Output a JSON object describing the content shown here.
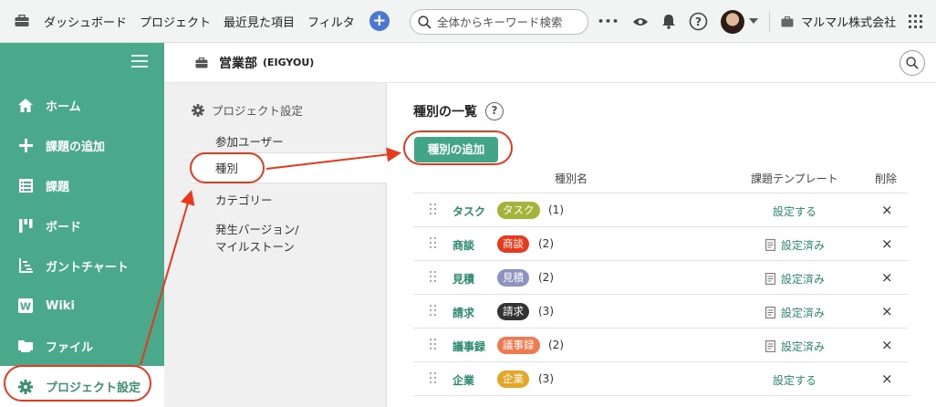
{
  "topbar": {
    "nav": [
      "ダッシュボード",
      "プロジェクト",
      "最近見た項目",
      "フィルタ"
    ],
    "add_label": "+",
    "search_placeholder": "全体からキーワード検索",
    "more_label": "•••",
    "company": "マルマル株式会社"
  },
  "sidebar": {
    "items": [
      {
        "label": "ホーム",
        "icon": "home-icon"
      },
      {
        "label": "課題の追加",
        "icon": "plus-icon"
      },
      {
        "label": "課題",
        "icon": "list-icon"
      },
      {
        "label": "ボード",
        "icon": "board-icon"
      },
      {
        "label": "ガントチャート",
        "icon": "gantt-icon"
      },
      {
        "label": "Wiki",
        "icon": "wiki-icon"
      },
      {
        "label": "ファイル",
        "icon": "folder-icon"
      },
      {
        "label": "プロジェクト設定",
        "icon": "gear-icon",
        "active": true
      }
    ]
  },
  "project": {
    "name": "営業部",
    "key": "(EIGYOU)"
  },
  "settings_panel": {
    "title": "プロジェクト設定",
    "items": [
      "参加ユーザー",
      "種別",
      "カテゴリー",
      "発生バージョン/",
      "マイルストーン"
    ],
    "active": "種別"
  },
  "main": {
    "title": "種別の一覧",
    "help_label": "?",
    "add_button": "種別の追加",
    "columns": {
      "name": "種別名",
      "template": "課題テンプレート",
      "delete": "削除"
    },
    "rows": [
      {
        "name": "タスク",
        "badge": "タスク",
        "color": "#a4b43a",
        "count": "(1)",
        "template": "設定する",
        "has_template": false
      },
      {
        "name": "商談",
        "badge": "商談",
        "color": "#e8391c",
        "count": "(2)",
        "template": "設定済み",
        "has_template": true
      },
      {
        "name": "見積",
        "badge": "見積",
        "color": "#8d93c0",
        "count": "(2)",
        "template": "設定済み",
        "has_template": true
      },
      {
        "name": "請求",
        "badge": "請求",
        "color": "#333333",
        "count": "(3)",
        "template": "設定済み",
        "has_template": true
      },
      {
        "name": "議事録",
        "badge": "議事録",
        "color": "#f07a4f",
        "count": "(2)",
        "template": "設定済み",
        "has_template": true
      },
      {
        "name": "企業",
        "badge": "企業",
        "color": "#e5a526",
        "count": "(3)",
        "template": "設定する",
        "has_template": false
      }
    ],
    "delete_label": "×"
  },
  "colors": {
    "accent": "#4aa98a",
    "annotation": "#e8391c",
    "link": "#2a8a6c"
  }
}
